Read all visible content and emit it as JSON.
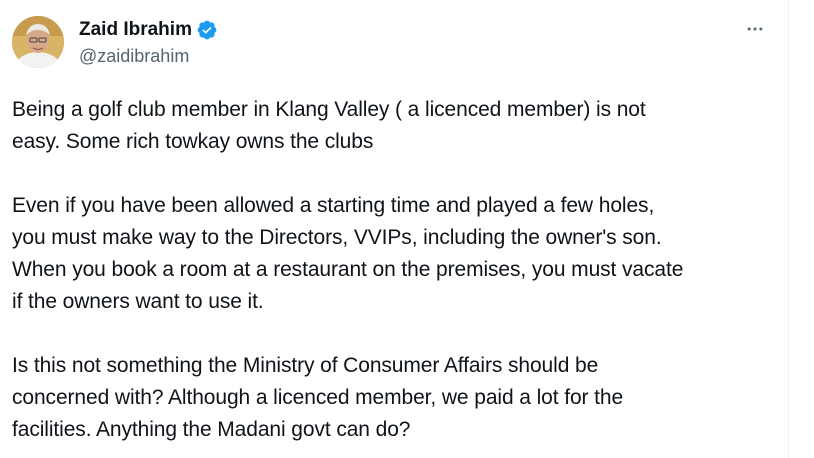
{
  "author": {
    "display_name": "Zaid Ibrahim",
    "handle": "@zaidibrahim",
    "verified": true,
    "avatar_icon": "profile-photo",
    "verified_color": "#1d9bf0"
  },
  "more_icon": "ellipsis-icon",
  "tweet": {
    "paragraphs": [
      {
        "lines": [
          "Being a golf club member in Klang Valley ( a licenced member) is not",
          "easy. Some rich towkay owns the clubs"
        ]
      },
      {
        "lines": [
          "Even if you have been allowed a starting time and played a few holes,",
          "you must make way to the Directors, VVIPs, including the owner's son.",
          "When you book a room at a restaurant on the premises, you must vacate",
          "if the owners want to use it."
        ]
      },
      {
        "lines": [
          "Is this not something the Ministry of Consumer Affairs should be",
          "concerned with? Although a licenced member, we paid a lot for the",
          "facilities. Anything the Madani govt can do?"
        ]
      }
    ]
  }
}
